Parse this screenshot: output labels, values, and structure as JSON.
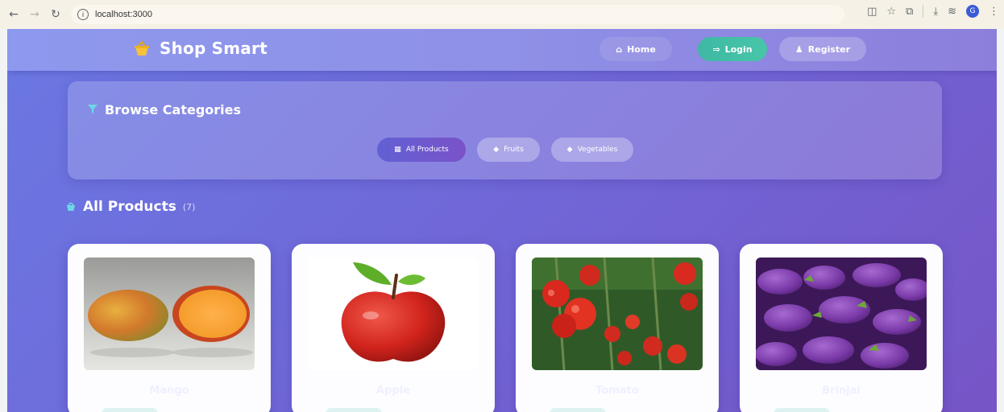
{
  "browser": {
    "url": "localhost:3000",
    "profile_initial": "G"
  },
  "navbar": {
    "brand": "Shop Smart",
    "home": "Home",
    "login": "Login",
    "register": "Register"
  },
  "categories": {
    "title": "Browse Categories",
    "buttons": [
      "All Products",
      "Fruits",
      "Vegetables"
    ]
  },
  "products_section": {
    "title": "All Products",
    "count": "(7)"
  },
  "products": [
    {
      "name": "Mango"
    },
    {
      "name": "Apple"
    },
    {
      "name": "Tomato"
    },
    {
      "name": "Brinjal"
    }
  ],
  "colors": {
    "accent": "#6a78e3",
    "login": "#3fb8a4",
    "active_category": "#6260d4"
  }
}
